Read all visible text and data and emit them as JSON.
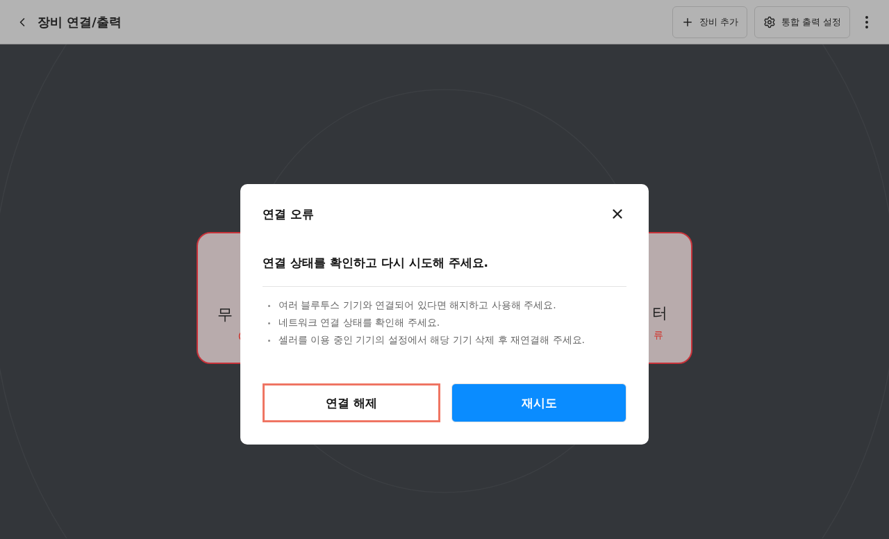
{
  "header": {
    "title": "장비 연결/출력",
    "actions": [
      {
        "label": "장비 추가",
        "kind": "add"
      },
      {
        "label": "통합 출력 설정",
        "kind": "settings"
      }
    ]
  },
  "devices": [
    {
      "name": "무",
      "error": true
    },
    {
      "name": "터",
      "status": "류",
      "error": true
    }
  ],
  "dialog": {
    "title": "연결 오류",
    "message": "연결 상태를 확인하고 다시 시도해 주세요.",
    "tips": [
      "여러 블루투스 기기와 연결되어 있다면 해지하고 사용해 주세요.",
      "네트워크 연결 상태를 확인해 주세요.",
      "셀러를 이용 중인 기기의 설정에서 해당 기기 삭제 후 재연결해 주세요."
    ],
    "buttons": [
      {
        "label": "연결 해제",
        "kind": "secondary",
        "focused": true
      },
      {
        "label": "재시도",
        "kind": "primary",
        "focused": false
      }
    ]
  }
}
